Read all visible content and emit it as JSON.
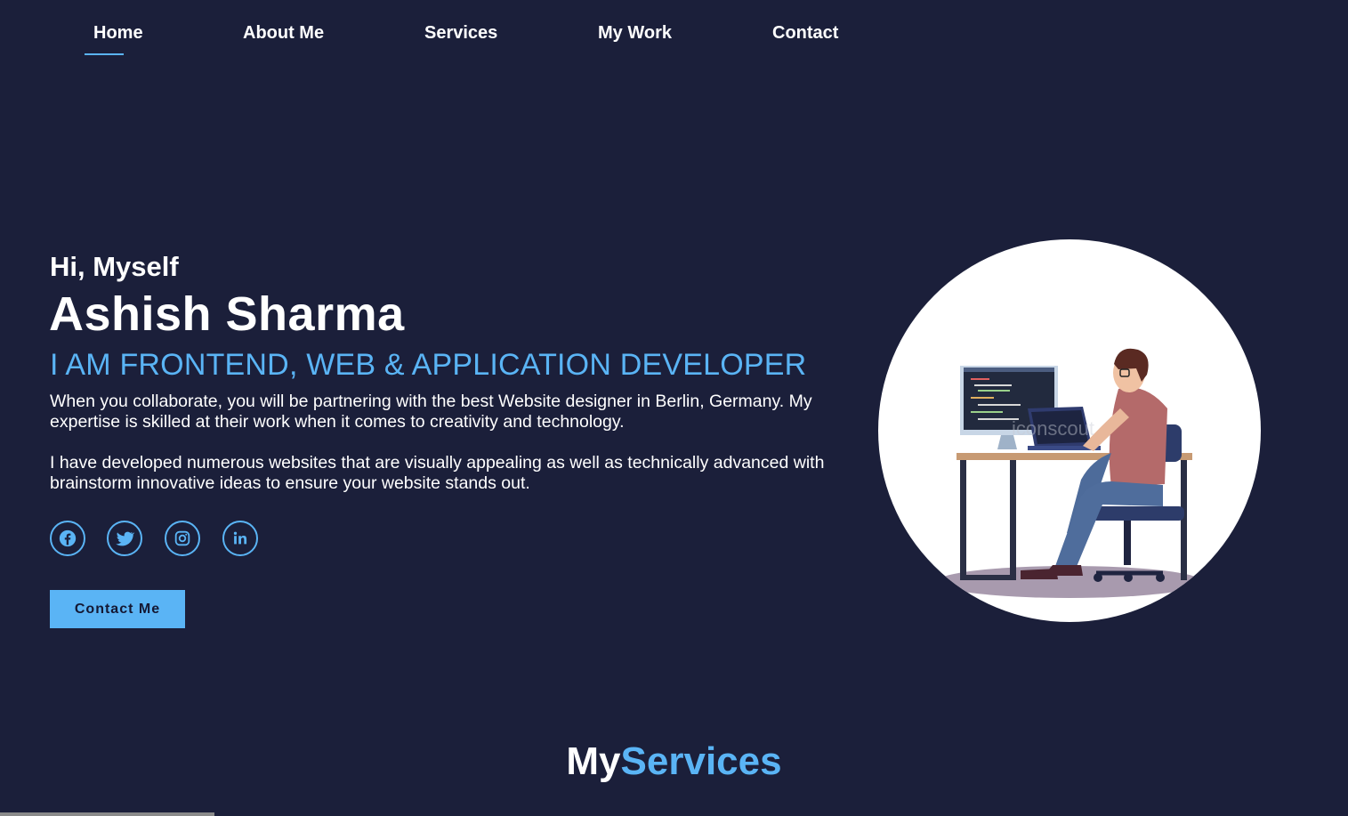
{
  "nav": {
    "items": [
      {
        "label": "Home",
        "active": true
      },
      {
        "label": "About Me"
      },
      {
        "label": "Services"
      },
      {
        "label": "My Work"
      },
      {
        "label": "Contact"
      }
    ]
  },
  "hero": {
    "greeting": "Hi, Myself",
    "name": "Ashish Sharma",
    "role": "I AM FRONTEND, WEB & APPLICATION DEVELOPER",
    "paragraph1": "When you collaborate, you will be partnering with the best Website designer in Berlin, Germany. My expertise is skilled at their work when it comes to creativity and technology.",
    "paragraph2": "I have developed numerous websites that are visually appealing as well as technically advanced with brainstorm innovative ideas to ensure your website stands out.",
    "social": [
      "facebook-icon",
      "twitter-icon",
      "instagram-icon",
      "linkedin-icon"
    ],
    "cta_label": "Contact Me"
  },
  "services": {
    "title_part1": "My",
    "title_part2": "Services"
  },
  "colors": {
    "background": "#1b1f3a",
    "accent": "#5ab4f5",
    "text": "#ffffff"
  }
}
